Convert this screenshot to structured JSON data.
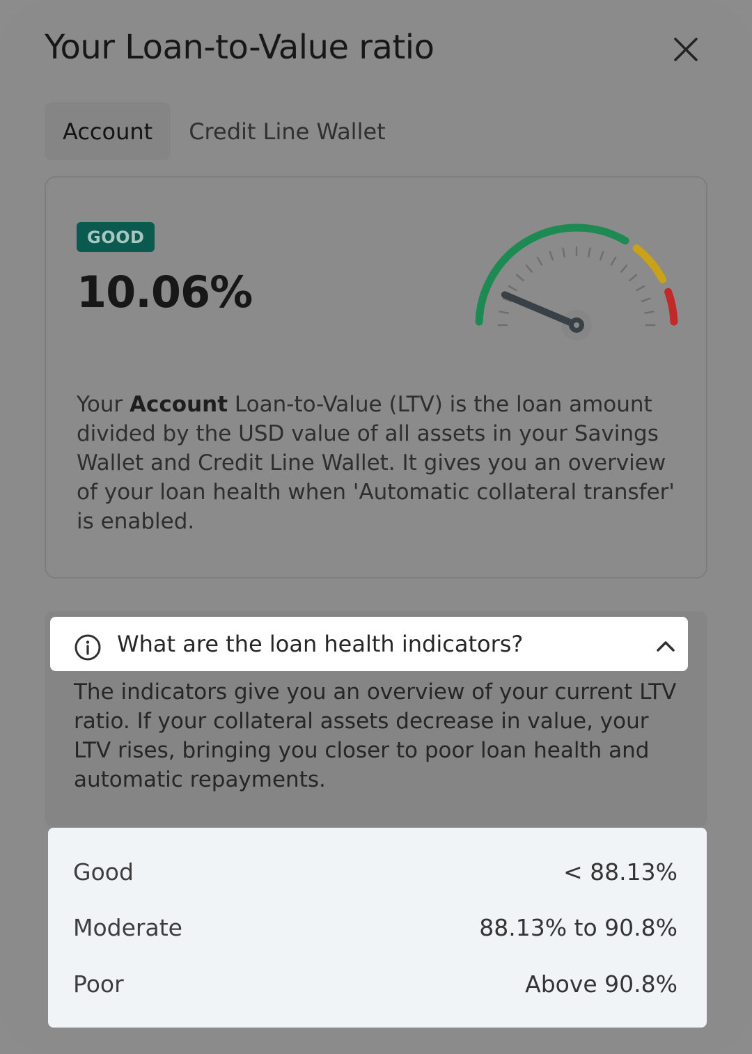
{
  "dialog": {
    "title": "Your Loan-to-Value ratio"
  },
  "tabs": [
    {
      "label": "Account",
      "active": true
    },
    {
      "label": "Credit Line Wallet",
      "active": false
    }
  ],
  "ltv": {
    "status_badge": "GOOD",
    "value": "10.06%",
    "gauge_fraction": 0.1006,
    "gauge_colors": {
      "good": "#1c8a52",
      "moderate": "#c9a21a",
      "poor": "#c22a2a"
    },
    "description": {
      "p1": "Your ",
      "bold": "Account",
      "p2": " Loan-to-Value (LTV) is the loan amount divided by the USD value of all assets in your Savings Wallet and Credit Line Wallet. It gives you an overview of your loan health when 'Automatic collateral transfer' is enabled."
    }
  },
  "faq": {
    "question": "What are the loan health indicators?",
    "answer": "The indicators give you an overview of your current LTV ratio. If your collateral assets decrease in value, your LTV rises, bringing you closer to poor loan health and automatic repayments."
  },
  "indicators": [
    {
      "label": "Good",
      "value": "< 88.13%"
    },
    {
      "label": "Moderate",
      "value": "88.13% to 90.8%"
    },
    {
      "label": "Poor",
      "value": "Above 90.8%"
    }
  ],
  "icons": {
    "close": "close-icon",
    "info": "info-icon",
    "chevron": "chevron-up-icon"
  }
}
